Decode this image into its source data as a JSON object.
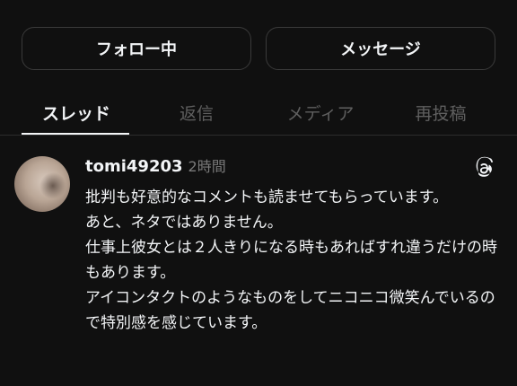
{
  "profile_actions": {
    "follow_label": "フォロー中",
    "message_label": "メッセージ"
  },
  "tabs": [
    {
      "label": "スレッド",
      "active": true
    },
    {
      "label": "返信",
      "active": false
    },
    {
      "label": "メディア",
      "active": false
    },
    {
      "label": "再投稿",
      "active": false
    }
  ],
  "post": {
    "username": "tomi49203",
    "timestamp": "2時間",
    "lines": [
      "批判も好意的なコメントも読ませてもらっています。",
      "あと、ネタではありません。",
      "仕事上彼女とは２人きりになる時もあればすれ違うだけの時もあります。",
      "アイコンタクトのようなものをしてニコニコ微笑んでいるので特別感を感じています。"
    ]
  },
  "icons": {
    "threads": "threads-logo-icon",
    "avatar": "user-avatar"
  },
  "colors": {
    "background": "#101010",
    "text_primary": "#f3f5f7",
    "text_muted": "#7a7a7a",
    "border": "#3a3a3a"
  }
}
